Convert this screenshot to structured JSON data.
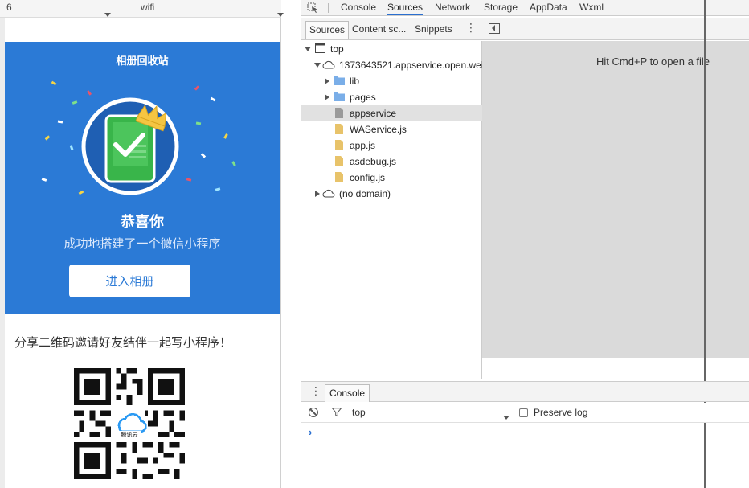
{
  "simulator": {
    "top_bar": {
      "left_value": "6",
      "network": "wifi"
    },
    "banner": {
      "title": "相册回收站",
      "heading": "恭喜你",
      "subtitle": "成功地搭建了一个微信小程序",
      "button_label": "进入相册",
      "colors": {
        "background": "#2b7ad6",
        "card": "#39b54a",
        "crown": "#f5c542"
      }
    },
    "share_text": "分享二维码邀请好友结伴一起写小程序！",
    "qr_label": "腾讯云"
  },
  "devtools": {
    "tabs": [
      {
        "label": "Console",
        "active": false
      },
      {
        "label": "Sources",
        "active": true
      },
      {
        "label": "Network",
        "active": false
      },
      {
        "label": "Storage",
        "active": false
      },
      {
        "label": "AppData",
        "active": false
      },
      {
        "label": "Wxml",
        "active": false
      }
    ],
    "navigator_tabs": [
      {
        "label": "Sources",
        "active": true
      },
      {
        "label": "Content sc...",
        "active": false
      },
      {
        "label": "Snippets",
        "active": false
      }
    ],
    "file_tree": [
      {
        "label": "top",
        "icon": "frame-icon",
        "expanded": true
      },
      {
        "label": "1373643521.appservice.open.wei",
        "icon": "cloud-icon",
        "expanded": true
      },
      {
        "label": "lib",
        "icon": "folder-icon",
        "expanded": false
      },
      {
        "label": "pages",
        "icon": "folder-icon",
        "expanded": false
      },
      {
        "label": "appservice",
        "icon": "file-icon",
        "selected": true
      },
      {
        "label": "WAService.js",
        "icon": "js-file-icon"
      },
      {
        "label": "app.js",
        "icon": "js-file-icon"
      },
      {
        "label": "asdebug.js",
        "icon": "js-file-icon"
      },
      {
        "label": "config.js",
        "icon": "js-file-icon"
      },
      {
        "label": "(no domain)",
        "icon": "cloud-icon",
        "expanded": false
      }
    ],
    "editor_hint": "Hit Cmd+P to open a file",
    "drawer": {
      "tab_label": "Console",
      "context": "top",
      "preserve_log_label": "Preserve log",
      "preserve_log_checked": false,
      "prompt": "›"
    },
    "colors": {
      "accent": "#2a6fd0",
      "folder": "#7aaee8",
      "js_file": "#e8c36a"
    }
  }
}
